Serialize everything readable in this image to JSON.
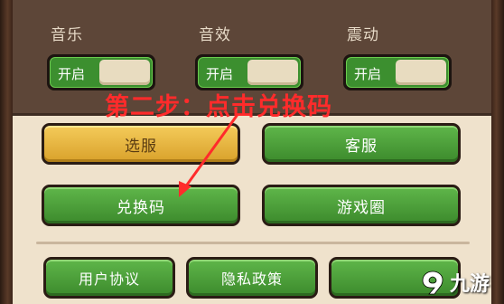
{
  "settings": {
    "music_label": "音乐",
    "sfx_label": "音效",
    "vibration_label": "震动",
    "toggle_on_label": "开启"
  },
  "annotation": {
    "caption": "第二步：点击兑换码",
    "color": "#ff2b2b"
  },
  "buttons": {
    "server_select": "选服",
    "customer_service": "客服",
    "redeem_code": "兑换码",
    "game_circle": "游戏圈",
    "user_agreement": "用户协议",
    "privacy_policy": "隐私政策"
  },
  "watermark": {
    "text": "九游",
    "icon": "9-logo-icon"
  },
  "colors": {
    "green_button": "#4ea23b",
    "gold_button": "#e6b541",
    "panel_bg": "#efe2cc",
    "top_section_bg": "#5d4638"
  }
}
